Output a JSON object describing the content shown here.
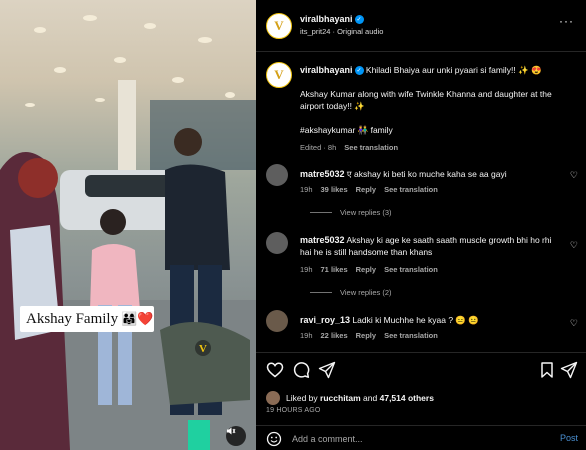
{
  "video": {
    "sticker_text": "Akshay Family",
    "sticker_emoji": "👨‍👩‍👧❤️"
  },
  "post": {
    "username": "viralbhayani",
    "audio_line": "its_prit24 · Original audio",
    "more_label": "···"
  },
  "caption": {
    "username": "viralbhayani",
    "line1": "Khiladi Bhaiya aur unki pyaari si family!! ✨ 😍",
    "line2": "Akshay Kumar along with wife Twinkle Khanna and daughter at the airport today!! ✨",
    "hashtags": "#akshaykumar 👫 family",
    "edited": "Edited · 8h",
    "see_translation": "See translation"
  },
  "comments": [
    {
      "username": "matre5032",
      "text": "ए akshay ki beti ko muche kaha se aa gayi",
      "time": "19h",
      "likes": "39 likes",
      "reply": "Reply",
      "translate": "See translation",
      "view_replies": "View replies (3)"
    },
    {
      "username": "matre5032",
      "text": "Akshay ki age ke saath saath muscle growth bhi ho rhi hai he is still handsome than khans",
      "time": "19h",
      "likes": "71 likes",
      "reply": "Reply",
      "translate": "See translation",
      "view_replies": "View replies (2)"
    },
    {
      "username": "ravi_roy_13",
      "text": "Ladki ki Muchhe he kyaa ? 😑 😐",
      "time": "19h",
      "likes": "22 likes",
      "reply": "Reply",
      "translate": "See translation"
    }
  ],
  "likes": {
    "prefix": "Liked by",
    "user": "rucchitam",
    "and": "and",
    "count": "47,514 others"
  },
  "timestamp": "19 HOURS AGO",
  "add_comment": {
    "placeholder": "Add a comment...",
    "post_label": "Post"
  },
  "icons": [
    "heart-icon",
    "comment-icon",
    "share-icon",
    "bookmark-icon",
    "emoji-icon",
    "mute-icon",
    "verified-icon",
    "more-icon"
  ]
}
